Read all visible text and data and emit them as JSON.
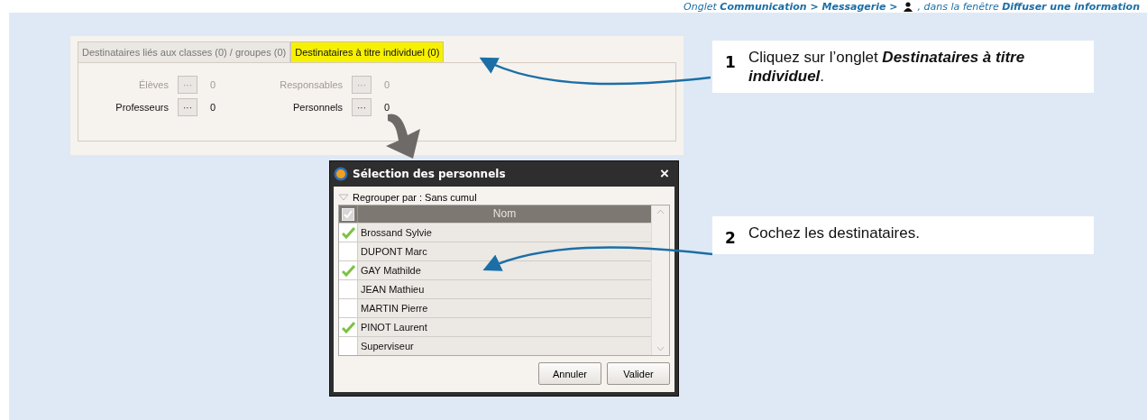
{
  "header": {
    "part_1": "Onglet **Communication > Messagerie >**",
    "part_2": ", dans la fenêtre **Diffuser une information**"
  },
  "tabs": [
    {
      "label": "Destinataires liés aux classes (0) / groupes (0)",
      "selected": false
    },
    {
      "label": "Destinataires à titre individuel (0)",
      "selected": true
    }
  ],
  "recipients": [
    {
      "label": "Élèves",
      "button": "···",
      "count": "0",
      "disabled": true
    },
    {
      "label": "Responsables",
      "button": "···",
      "count": "0",
      "disabled": true
    },
    {
      "label": "Professeurs",
      "button": "···",
      "count": "0",
      "disabled": false
    },
    {
      "label": "Personnels",
      "button": "···",
      "count": "0",
      "disabled": false
    }
  ],
  "dialog": {
    "title": "Sélection des personnels",
    "close": "×",
    "group_by": "Regrouper par : Sans cumul",
    "column": "Nom",
    "rows": [
      {
        "name": "Brossand Sylvie",
        "checked": true
      },
      {
        "name": "DUPONT Marc",
        "checked": false
      },
      {
        "name": "GAY Mathilde",
        "checked": true
      },
      {
        "name": "JEAN Mathieu",
        "checked": false
      },
      {
        "name": "MARTIN Pierre",
        "checked": false
      },
      {
        "name": "PINOT Laurent",
        "checked": true
      },
      {
        "name": "Superviseur",
        "checked": false
      }
    ],
    "buttons": [
      "Annuler",
      "Valider"
    ]
  },
  "steps": [
    {
      "number": "1",
      "text": "Cliquez sur l’onglet **Destinataires à titre individuel**."
    },
    {
      "number": "2",
      "text": "Cochez les destinataires."
    }
  ]
}
